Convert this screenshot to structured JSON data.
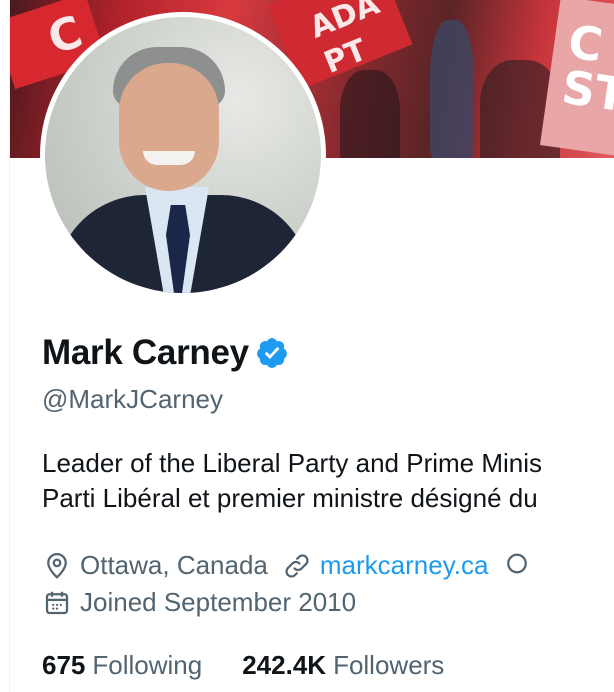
{
  "profile": {
    "name": "Mark Carney",
    "handle": "@MarkJCarney",
    "verified": true,
    "bio_line1": "Leader of the Liberal Party and Prime Minis",
    "bio_line2": "Parti Libéral et premier ministre désigné du",
    "location": "Ottawa, Canada",
    "website": "markcarney.ca",
    "joined": "Joined September 2010"
  },
  "stats": {
    "following_count": "675",
    "following_label": "Following",
    "followers_count": "242.4K",
    "followers_label": "Followers"
  },
  "banner": {
    "sign_1": "C",
    "sign_2": "ADA\nPT",
    "sign_3": "C\nST"
  },
  "icons": {
    "verified": "verified-badge-icon",
    "location": "location-pin-icon",
    "link": "link-icon",
    "calendar": "calendar-icon"
  },
  "colors": {
    "accent": "#1d9bf0",
    "text_primary": "#0f1419",
    "text_secondary": "#536471",
    "verified_badge": "#1d9bf0"
  }
}
